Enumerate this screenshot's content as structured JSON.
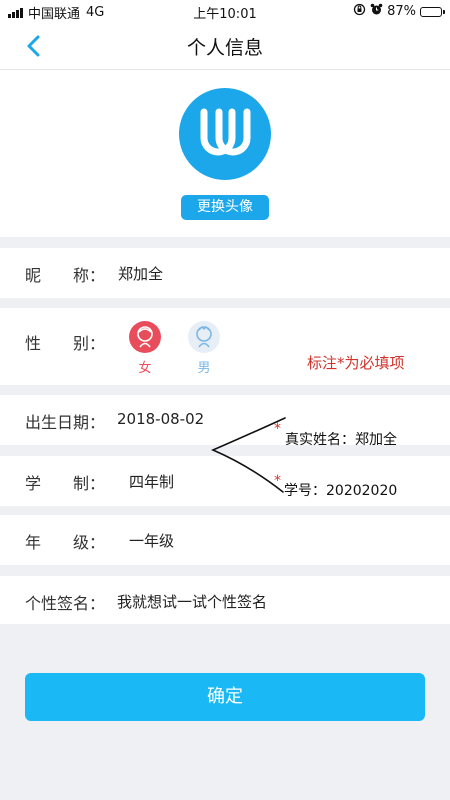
{
  "status_bar": {
    "carrier": "中国联通",
    "network": "4G",
    "time": "上午10:01",
    "battery": "87%",
    "battery_level": 0.87
  },
  "nav": {
    "title": "个人信息"
  },
  "avatar": {
    "change_button": "更换头像"
  },
  "nickname": {
    "label": "昵　　称：",
    "value": "郑加全"
  },
  "gender": {
    "label": "性　　别：",
    "female": "女",
    "male": "男",
    "female_color": "#e84d5b",
    "male_color": "#7bb7e6"
  },
  "birth_date": {
    "label": "出生日期：",
    "value": "2018-08-02"
  },
  "school_system": {
    "label": "学　　制：",
    "value": "四年制"
  },
  "grade": {
    "label": "年　　级：",
    "value": "一年级"
  },
  "signature": {
    "label": "个性签名：",
    "value": "我就想试一试个性签名"
  },
  "annotations": {
    "note": "标注*为必填项",
    "star": "*",
    "real_name": "真实姓名：郑加全",
    "student_id": "学号：20202020"
  },
  "confirm_button": "确定",
  "colors": {
    "accent": "#1ba7ea",
    "confirm": "#1ab9f5",
    "required": "#d0342c",
    "background": "#eff0f4"
  }
}
